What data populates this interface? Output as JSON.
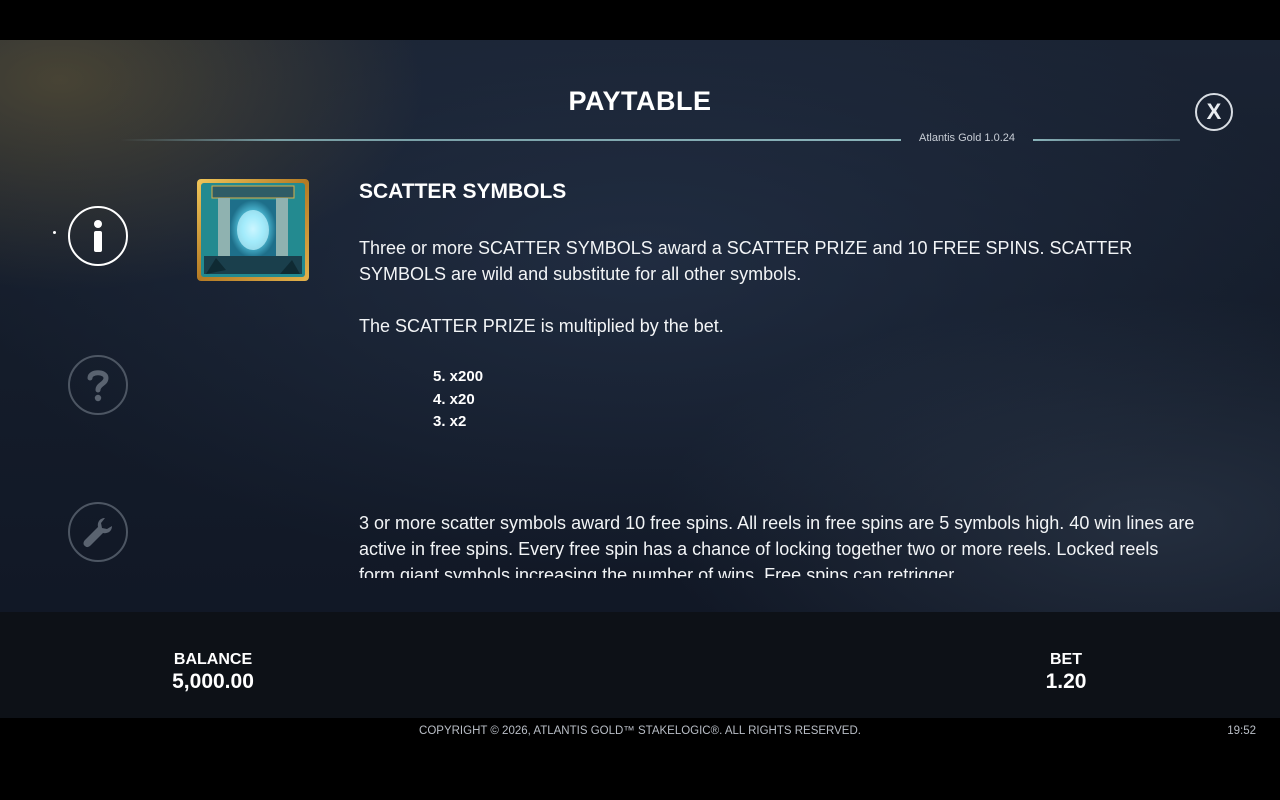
{
  "header": {
    "title": "PAYTABLE",
    "version": "Atlantis Gold 1.0.24",
    "close_label": "X"
  },
  "sidebar": {
    "items": [
      {
        "name": "info",
        "icon": "info-icon"
      },
      {
        "name": "help",
        "icon": "question-icon"
      },
      {
        "name": "settings",
        "icon": "wrench-icon"
      }
    ]
  },
  "section": {
    "title": "SCATTER SYMBOLS",
    "paragraph1": "Three or more SCATTER SYMBOLS award a SCATTER PRIZE and 10 FREE SPINS. SCATTER SYMBOLS are wild and substitute for all other symbols.",
    "paragraph2": "The SCATTER PRIZE is multiplied by the bet.",
    "prizes": [
      "5. x200",
      "4. x20",
      "3. x2"
    ],
    "paragraph3": "3 or more scatter symbols award 10 free spins. All reels in free spins are 5 symbols high. 40 win lines are active in free spins. Every free spin has a chance of locking together two or more reels. Locked reels form giant symbols increasing the number of wins. Free spins can retrigger."
  },
  "status": {
    "balance_label": "BALANCE",
    "balance_value": "5,000.00",
    "bet_label": "BET",
    "bet_value": "1.20"
  },
  "footer": {
    "copyright": "COPYRIGHT © 2026, ATLANTIS GOLD™ STAKELOGIC®. ALL RIGHTS RESERVED.",
    "clock": "19:52"
  },
  "colors": {
    "panel_bg": "#141c2a",
    "bar_bg": "#0d1117",
    "accent_line": "#96c3c8",
    "symbol_frame": "#c99a3a",
    "portal_glow": "#5fd6f0"
  }
}
